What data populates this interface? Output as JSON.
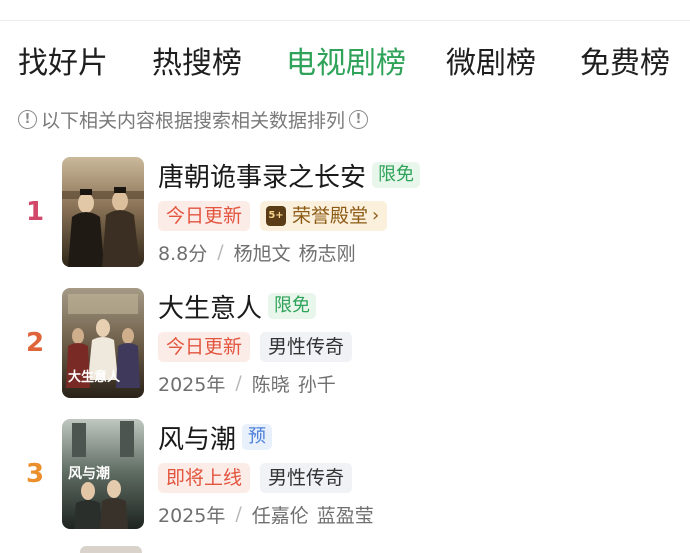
{
  "tabs": [
    {
      "label": "找好片",
      "active": false
    },
    {
      "label": "热搜榜",
      "active": false
    },
    {
      "label": "电视剧榜",
      "active": true
    },
    {
      "label": "微剧榜",
      "active": false
    },
    {
      "label": "免费榜",
      "active": false
    }
  ],
  "notice": {
    "text": "以下相关内容根据搜索相关数据排列"
  },
  "items": [
    {
      "rank": "1",
      "title": "唐朝诡事录之长安",
      "badge": "限免",
      "tags": [
        "今日更新",
        "荣誉殿堂"
      ],
      "honor_icon": "5+",
      "meta_first": "8.8分",
      "people": [
        "杨旭文",
        "杨志刚"
      ]
    },
    {
      "rank": "2",
      "title": "大生意人",
      "badge": "限免",
      "tags": [
        "今日更新",
        "男性传奇"
      ],
      "poster_text": "大生意人",
      "meta_first": "2025年",
      "people": [
        "陈晓",
        "孙千"
      ]
    },
    {
      "rank": "3",
      "title": "风与潮",
      "badge": "预",
      "tags": [
        "即将上线",
        "男性传奇"
      ],
      "poster_text": "风与潮",
      "meta_first": "2025年",
      "people": [
        "任嘉伦",
        "蓝盈莹"
      ]
    }
  ],
  "colors": {
    "accent": "#2fa35a",
    "update": "#e2553e",
    "preview": "#4b7fd8"
  },
  "icons": {
    "notice_left": "info-circle-icon",
    "notice_right": "info-circle-icon",
    "chevron": "chevron-right-icon"
  }
}
